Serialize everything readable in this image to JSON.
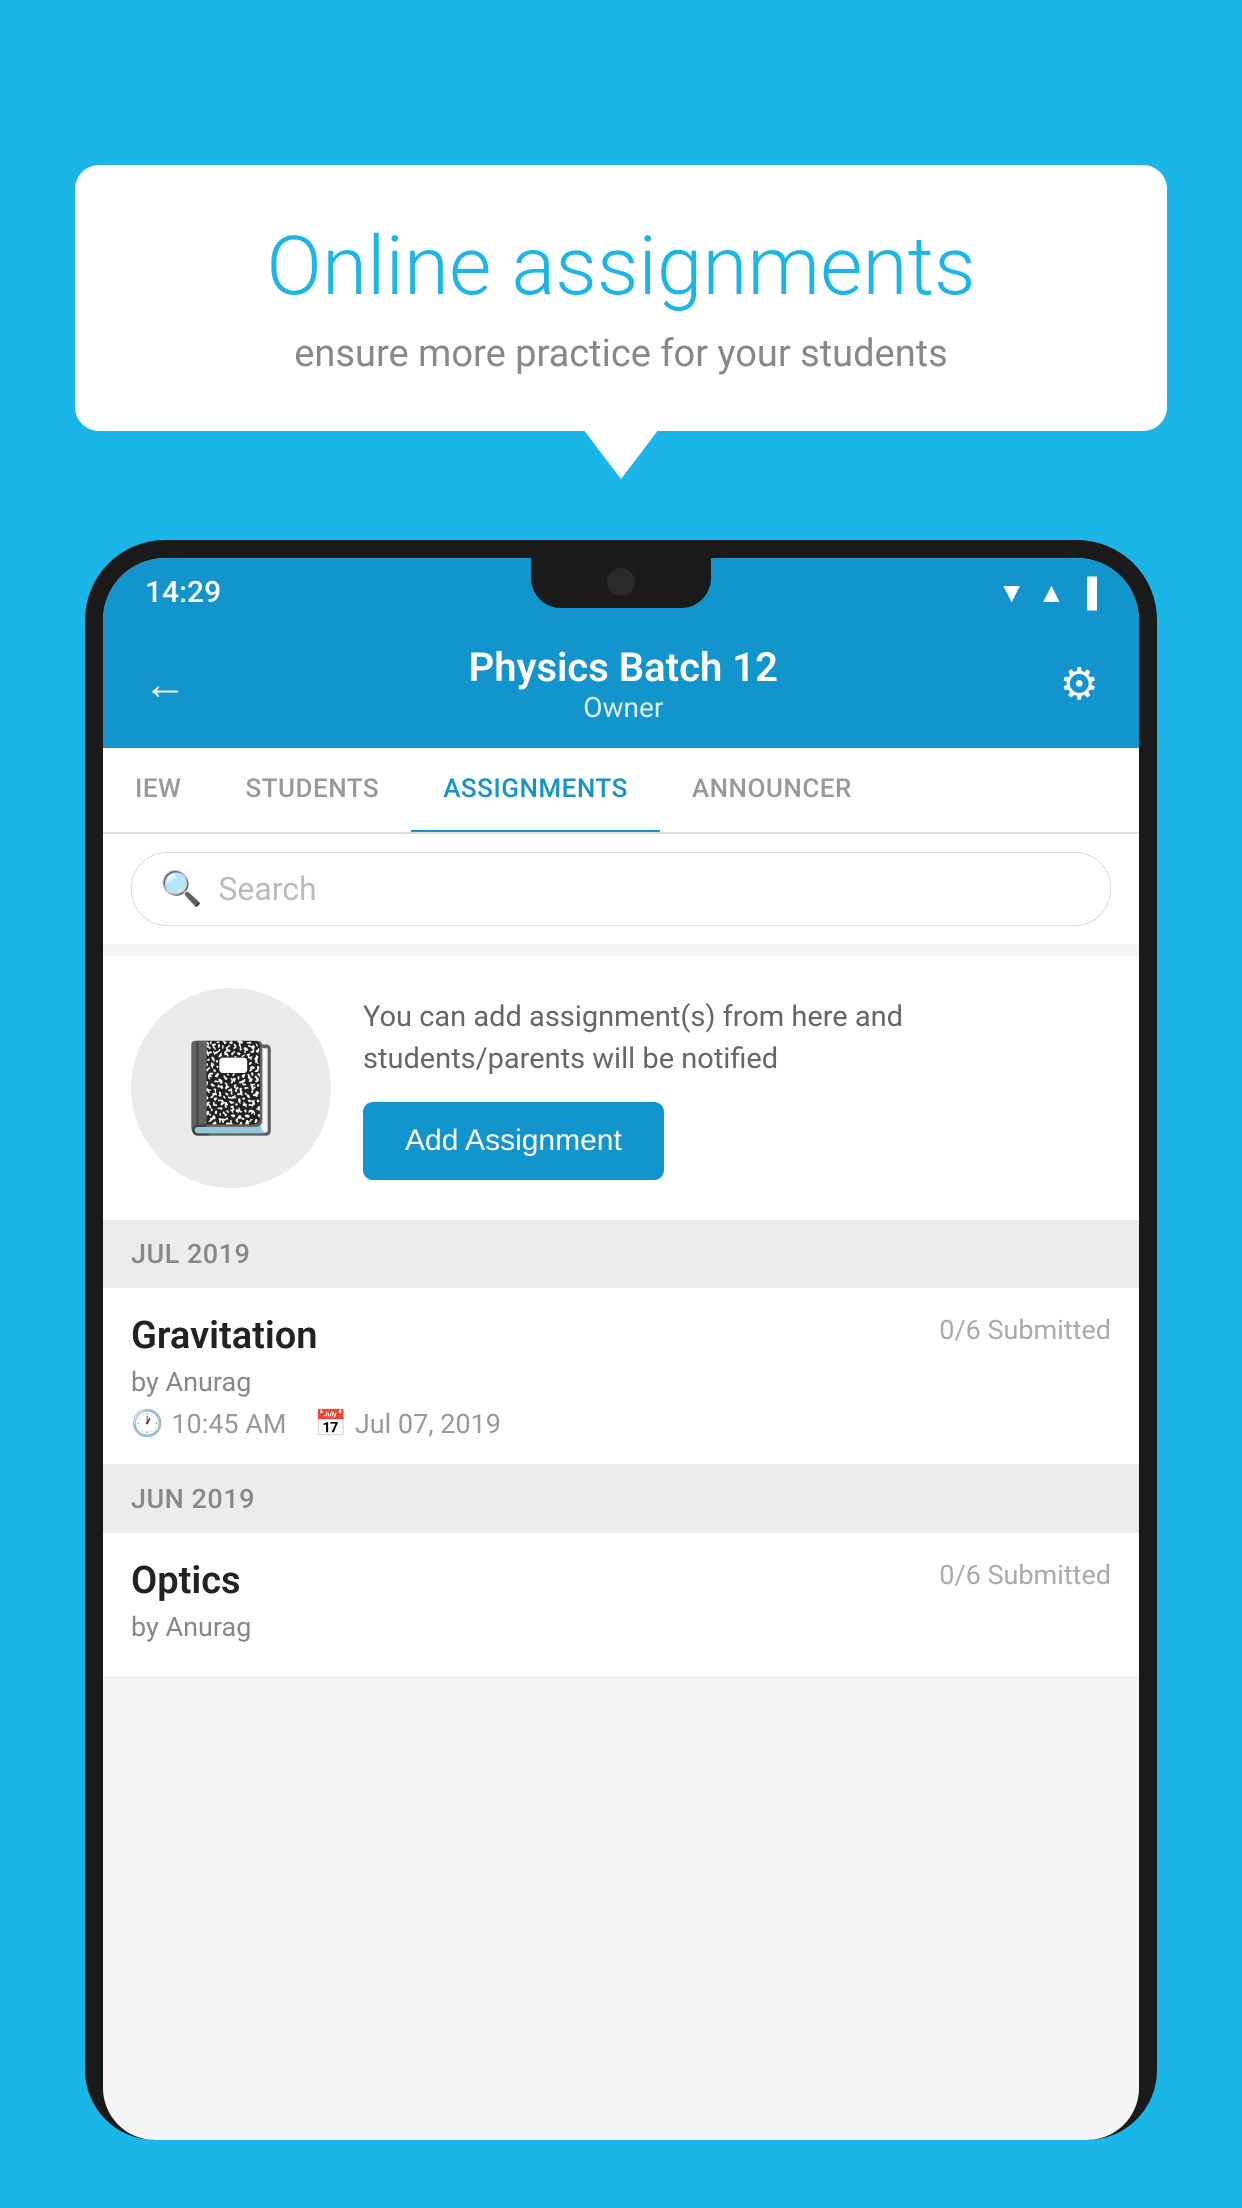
{
  "background_color": "#1ab6e8",
  "speech_bubble": {
    "title": "Online assignments",
    "subtitle": "ensure more practice for your students"
  },
  "phone": {
    "status_bar": {
      "time": "14:29",
      "wifi": "▲",
      "signal": "▲",
      "battery": "▌"
    },
    "header": {
      "title": "Physics Batch 12",
      "subtitle": "Owner",
      "back_label": "←",
      "settings_label": "⚙"
    },
    "tabs": [
      {
        "label": "IEW",
        "active": false
      },
      {
        "label": "STUDENTS",
        "active": false
      },
      {
        "label": "ASSIGNMENTS",
        "active": true
      },
      {
        "label": "ANNOUNCER",
        "active": false
      }
    ],
    "search": {
      "placeholder": "Search"
    },
    "promo": {
      "description": "You can add assignment(s) from here and students/parents will be notified",
      "button_label": "Add Assignment"
    },
    "section_jul": "JUL 2019",
    "assignment_1": {
      "name": "Gravitation",
      "submitted": "0/6 Submitted",
      "by": "by Anurag",
      "time": "10:45 AM",
      "date": "Jul 07, 2019"
    },
    "section_jun": "JUN 2019",
    "assignment_2": {
      "name": "Optics",
      "submitted": "0/6 Submitted",
      "by": "by Anurag"
    }
  }
}
